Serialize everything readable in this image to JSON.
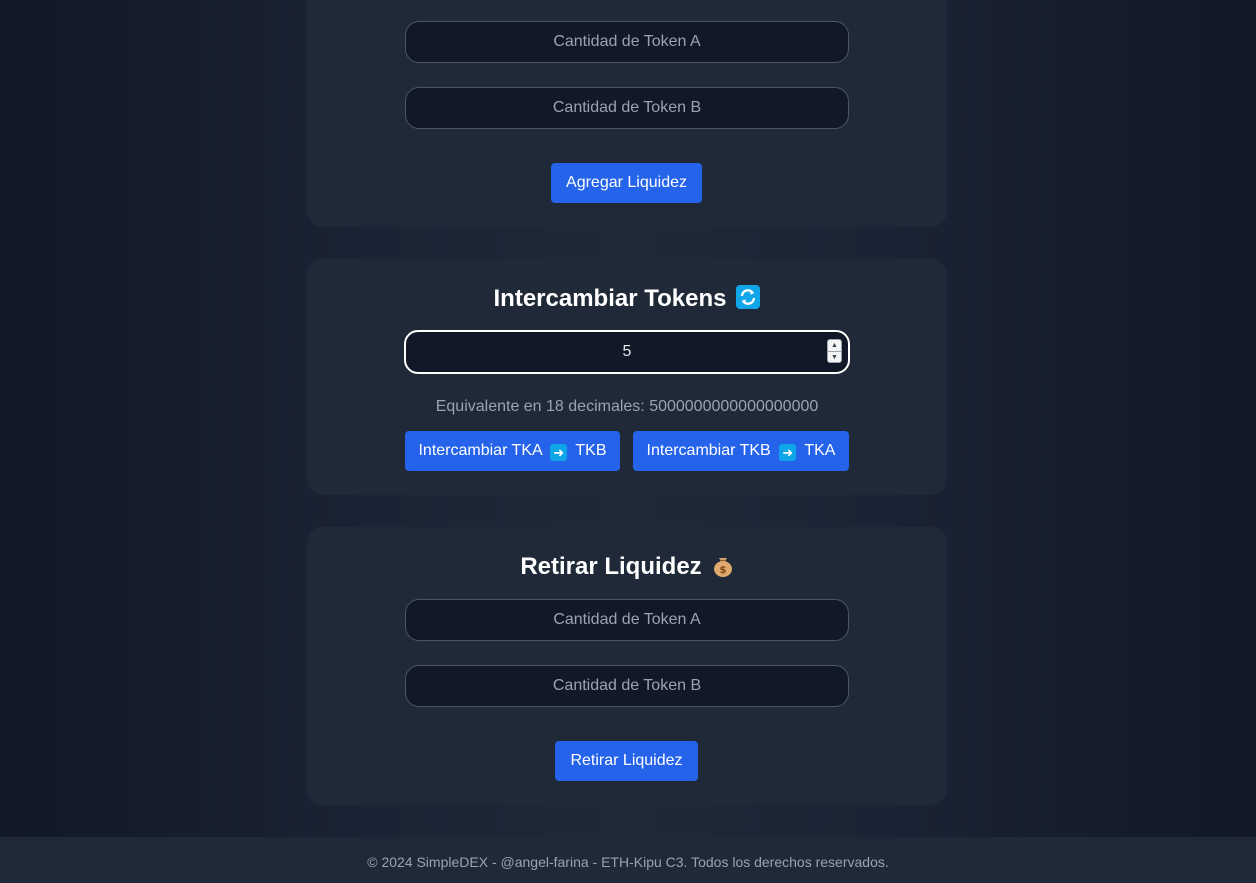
{
  "add_liquidity": {
    "token_a_placeholder": "Cantidad de Token A",
    "token_b_placeholder": "Cantidad de Token B",
    "button_label": "Agregar Liquidez"
  },
  "swap": {
    "title": "Intercambiar Tokens",
    "title_icon": "arrows-counterclockwise-icon",
    "amount_value": "5",
    "equivalent_text": "Equivalente en 18 decimales: 5000000000000000000",
    "button_a_to_b": {
      "from": "Intercambiar TKA",
      "to": "TKB"
    },
    "button_b_to_a": {
      "from": "Intercambiar TKB",
      "to": "TKA"
    }
  },
  "remove_liquidity": {
    "title": "Retirar Liquidez",
    "title_icon": "money-bag-icon",
    "token_a_placeholder": "Cantidad de Token A",
    "token_b_placeholder": "Cantidad de Token B",
    "button_label": "Retirar Liquidez"
  },
  "footer": {
    "text": "© 2024 SimpleDEX - @angel-farina - ETH-Kipu C3. Todos los derechos reservados."
  },
  "colors": {
    "background": "#111827",
    "card": "#1f2937",
    "accent": "#2563eb",
    "input_bg": "#111827"
  }
}
